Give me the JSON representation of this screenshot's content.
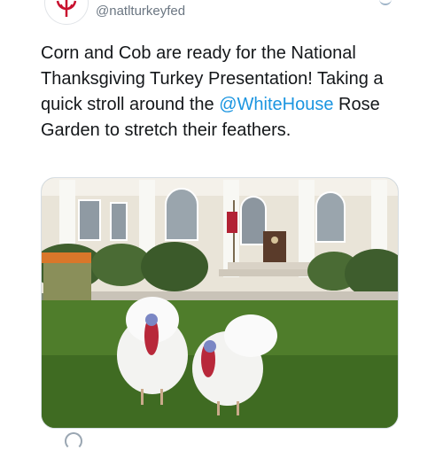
{
  "tweet": {
    "handle": "@natlturkeyfed",
    "text_before": "Corn and Cob are ready for the National Thanksgiving Turkey Presentation! Taking a quick stroll around the ",
    "mention": "@WhiteHouse",
    "text_after": " Rose Garden to stretch their feathers."
  },
  "icons": {
    "avatar": "turkey-federation-logo",
    "bottom": "reply-icon"
  },
  "colors": {
    "text": "#14171a",
    "handle": "#6b7682",
    "mention": "#1b95e0"
  }
}
